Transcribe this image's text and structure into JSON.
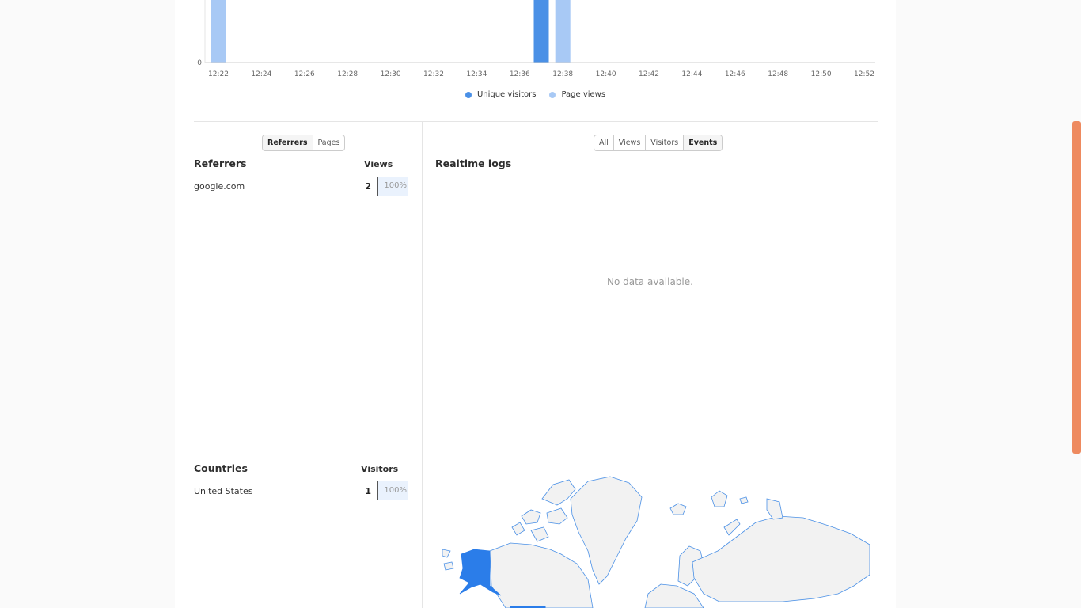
{
  "chart_data": {
    "type": "bar",
    "categories": [
      "12:22",
      "12:37",
      "12:38"
    ],
    "series": [
      {
        "name": "Unique visitors",
        "points": [
          {
            "x": "12:37",
            "y": 1
          }
        ]
      },
      {
        "name": "Page views",
        "points": [
          {
            "x": "12:22",
            "y": 1
          },
          {
            "x": "12:38",
            "y": 1
          }
        ]
      }
    ],
    "x_ticks": [
      "12:22",
      "12:24",
      "12:26",
      "12:28",
      "12:30",
      "12:32",
      "12:34",
      "12:36",
      "12:38",
      "12:40",
      "12:42",
      "12:44",
      "12:46",
      "12:48",
      "12:50",
      "12:52"
    ],
    "y_ticks": [
      "0"
    ],
    "legend_position": "bottom",
    "colors": {
      "unique": "#4a90e6",
      "views": "#a8c9f5"
    }
  },
  "legend": {
    "unique_label": "Unique visitors",
    "views_label": "Page views"
  },
  "referrers": {
    "tabs": [
      "Referrers",
      "Pages"
    ],
    "selected": "Referrers",
    "title": "Referrers",
    "metric_header": "Views",
    "rows": [
      {
        "label": "google.com",
        "value": "2",
        "percent": "100%"
      }
    ]
  },
  "realtime": {
    "filters": [
      "All",
      "Views",
      "Visitors",
      "Events"
    ],
    "selected": "Events",
    "title": "Realtime logs",
    "empty_text": "No data available."
  },
  "countries": {
    "title": "Countries",
    "metric_header": "Visitors",
    "rows": [
      {
        "label": "United States",
        "value": "1",
        "percent": "100%"
      }
    ]
  },
  "map_colors": {
    "land": "#f2f2f2",
    "border": "#4a90e6",
    "highlight": "#2b7de9"
  },
  "scrollbar_color": "#ee8a5f"
}
